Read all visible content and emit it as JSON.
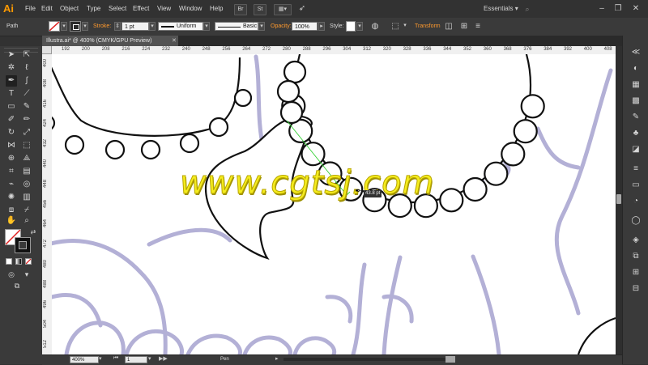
{
  "app": {
    "logo": "Ai",
    "workspace": "Essentials",
    "workspace_arrow": "▾"
  },
  "menu": [
    "File",
    "Edit",
    "Object",
    "Type",
    "Select",
    "Effect",
    "View",
    "Window",
    "Help"
  ],
  "menu_buttons": [
    "Br",
    "St"
  ],
  "window_controls": [
    "–",
    "❐",
    "✕"
  ],
  "control_bar": {
    "selection_label": "Path",
    "stroke_label": "Stroke:",
    "stroke_weight": "1 pt",
    "profile_uniform": "Uniform",
    "brush_basic": "Basic",
    "opacity_label": "Opacity:",
    "opacity_value": "100%",
    "style_label": "Style:",
    "transform_label": "Transform"
  },
  "document_tab": {
    "title": "Illustra.ai* @ 400% (CMYK/GPU Preview)",
    "close": "✕"
  },
  "ruler_top_labels": [
    "192",
    "200",
    "208",
    "216",
    "224",
    "232",
    "240",
    "248",
    "256",
    "264",
    "272",
    "280",
    "288",
    "296",
    "304",
    "312",
    "320",
    "328",
    "336",
    "344",
    "352",
    "360",
    "368",
    "376",
    "384",
    "392",
    "400",
    "408"
  ],
  "ruler_left_labels": [
    "400",
    "408",
    "416",
    "424",
    "432",
    "440",
    "448",
    "456",
    "464",
    "472",
    "480",
    "488",
    "496",
    "504",
    "512",
    "520"
  ],
  "status_bar": {
    "zoom": "400%",
    "artboard": "1",
    "tool_name": "Pen"
  },
  "pen_tooltip": "43.8 pt",
  "watermark": "www.cgtsj.com",
  "colors": {
    "ui_dark": "#323232",
    "accent_orange": "#ff9a2e",
    "sketch": "#b3b0d6",
    "guide": "#2fd02f",
    "watermark": "#f4ec1e"
  },
  "icons": {
    "tools": [
      "selection-icon",
      "direct-selection-icon",
      "magic-wand-icon",
      "lasso-icon",
      "pen-icon",
      "curvature-icon",
      "type-icon",
      "line-segment-icon",
      "rectangle-icon",
      "paintbrush-icon",
      "shaper-icon",
      "pencil-icon",
      "rotate-icon",
      "scale-icon",
      "width-icon",
      "free-transform-icon",
      "shape-builder-icon",
      "perspective-grid-icon",
      "mesh-icon",
      "gradient-icon",
      "eyedropper-icon",
      "blend-icon",
      "symbol-sprayer-icon",
      "column-graph-icon",
      "artboard-icon",
      "slice-icon",
      "hand-icon",
      "zoom-icon"
    ],
    "right_panels": [
      "color-icon",
      "color-guide-icon",
      "swatches-icon",
      "brushes-icon",
      "symbols-icon",
      "graphic-styles-icon",
      "stroke-icon",
      "gradient-panel-icon",
      "transparency-icon",
      "appearance-icon",
      "layers-icon",
      "artboards-icon",
      "links-icon",
      "align-icon"
    ]
  }
}
